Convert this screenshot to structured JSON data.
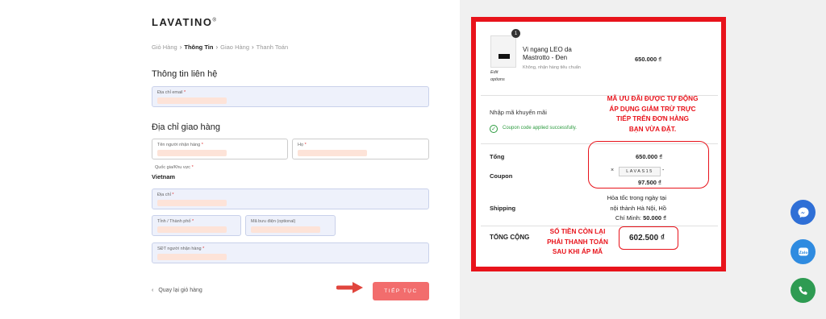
{
  "brand": {
    "name": "LAVATINO",
    "mark": "®"
  },
  "breadcrumb": {
    "items": [
      "Giỏ Hàng",
      "Thông Tin",
      "Giao Hàng",
      "Thanh Toán"
    ],
    "active_index": 1,
    "separator": "›"
  },
  "contact": {
    "heading": "Thông tin liên hệ",
    "email_label": "Địa chỉ email",
    "required_mark": "*"
  },
  "shipping_address": {
    "heading": "Địa chỉ giao hàng",
    "first_name_label": "Tên người nhận hàng",
    "last_name_label": "Họ",
    "country_label": "Quốc gia/Khu vực",
    "country_value": "Vietnam",
    "address_label": "Địa chỉ",
    "city_label": "Tỉnh / Thành phố",
    "postcode_label": "Mã bưu điện (optional)",
    "phone_label": "SĐT người nhận hàng"
  },
  "footer": {
    "back_label": "Quay lại giỏ hàng",
    "back_icon": "chevron-left-icon",
    "continue_label": "TIẾP TỤC"
  },
  "order_summary": {
    "item": {
      "quantity": "1",
      "name_line1": "Vi ngang LEO da",
      "name_line2": "Mastrotto - Đen",
      "shipping_note": "Không, nhận hàng tiêu chuẩn",
      "price": "650.000 ₫",
      "edit_line1": "Edit",
      "edit_line2": "options"
    },
    "promo_label": "Nhập mã khuyến mãi",
    "coupon_applied": "Coupon code applied successfully.",
    "subtotal_label": "Tổng",
    "subtotal_value": "650.000 ₫",
    "coupon_label": "Coupon",
    "coupon_remove": "×",
    "coupon_code": "LAVAS15",
    "coupon_dash": "-",
    "coupon_discount": "97.500 ₫",
    "shipping_label": "Shipping",
    "shipping_line1": "Hỏa tốc trong ngày tại",
    "shipping_line2": "nội thành Hà Nội, Hồ",
    "shipping_line3": "Chí Minh:",
    "shipping_price": "50.000 ₫",
    "total_label": "TỔNG CỘNG",
    "total_value": "602.500 ₫"
  },
  "annotations": {
    "note1_line1": "MÃ ƯU ĐÃI ĐƯỢC TỰ ĐỘNG",
    "note1_line2": "ÁP DỤNG GIẢM TRỪ TRỰC",
    "note1_line3": "TIẾP TRÊN ĐƠN HÀNG",
    "note1_line4": "BẠN VỪA ĐẶT.",
    "note2_line1": "SỐ TIỀN CÒN LẠI",
    "note2_line2": "PHẢI THANH TOÁN",
    "note2_line3": "SAU KHI ÁP MÃ"
  },
  "floating_buttons": [
    {
      "icon": "messenger-icon",
      "color": "#2f6fd6"
    },
    {
      "icon": "zalo-icon",
      "color": "#2f8be0"
    },
    {
      "icon": "phone-icon",
      "color": "#2e9b52"
    }
  ],
  "colors": {
    "accent": "#f26d6d",
    "annotation_red": "#e8131b",
    "success_green": "#2b9a3e",
    "field_fill": "#eef1fb"
  }
}
